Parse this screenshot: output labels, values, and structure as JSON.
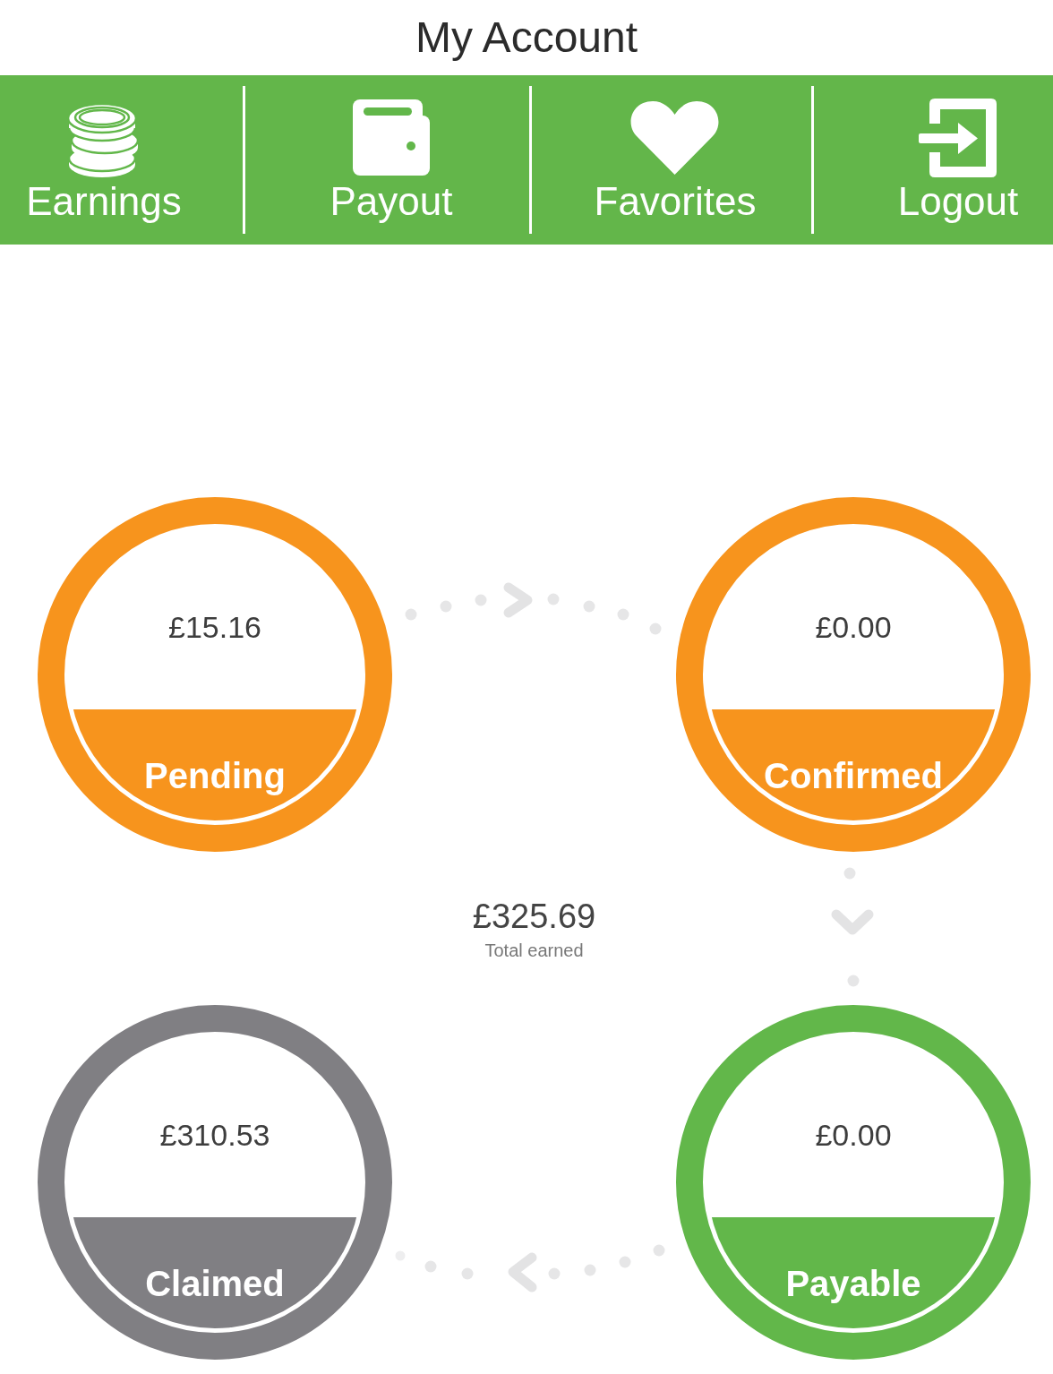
{
  "title": "My Account",
  "nav": [
    {
      "label": "Earnings"
    },
    {
      "label": "Payout"
    },
    {
      "label": "Favorites"
    },
    {
      "label": "Logout"
    }
  ],
  "statuses": [
    {
      "label": "Pending",
      "amount": "£15.16",
      "color": "#f7941d"
    },
    {
      "label": "Confirmed",
      "amount": "£0.00",
      "color": "#f7941d"
    },
    {
      "label": "Claimed",
      "amount": "£310.53",
      "color": "#807f83"
    },
    {
      "label": "Payable",
      "amount": "£0.00",
      "color": "#62b74a"
    }
  ],
  "total": {
    "amount": "£325.69",
    "label": "Total earned"
  }
}
